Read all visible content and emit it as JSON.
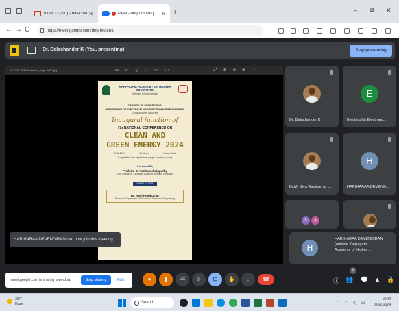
{
  "browser": {
    "tabs": [
      {
        "label": "Inbox (3,090) - balachander.k@k",
        "icon": "gmail-icon",
        "active": false
      },
      {
        "label": "Meet - deq-fxou-ntq",
        "icon": "meet-icon",
        "active": true,
        "recording": true
      }
    ],
    "new_tab": "+",
    "window_controls": {
      "minimize": "–",
      "restore": "⧉",
      "close": "✕"
    },
    "nav": {
      "back": "←",
      "forward": "→",
      "reload": "C"
    },
    "url": "https://meet.google.com/deq-fxou-ntq"
  },
  "meet": {
    "presenting_text": "Dr. Balachander K (You, presenting)",
    "stop_presenting": "Stop presenting",
    "viewer": {
      "filename": "NCCGE 2024 Invitation_page-0001.jpg",
      "tools": "⊕ ↺ ▯ ⊙ ▭ ⋯",
      "tools_right": "⤢ ⊟ ⊖ ⊕ ⋯"
    },
    "poster": {
      "university": "KARPAGAM ACADEMY OF HIGHER EDUCATION",
      "university_sub": "(Deemed to be University)",
      "faculty": "FACULTY OF ENGINEERING",
      "department": "DEPARTMENT OF ELECTRICAL AND ELECTRONICS ENGINEERING",
      "organizes": "Cordially invites you to the",
      "script": "Inaugural function of",
      "conference": "7th NATIONAL CONFERENCE ON",
      "title_line1": "CLEAN AND",
      "title_line2": "GREEN ENERGY 2024",
      "date": "10.02.2024",
      "time": "11.00 am",
      "venue": "Virtual Mode",
      "link": "Google Meet Link: https://meet.google.com/deq-fxou-ntq",
      "presided_by": "Presided By",
      "president": "Prof. Dr. B. Venkatachalapathy",
      "president_role": "Vice Chancellor, Karpagam Academy of Higher Education",
      "chief_guest_label": "CHIEF GUEST",
      "chief_guest": "Dr. Ravi Ramkumar",
      "chief_guest_role": "Professor, Department of Electrical & Electronics Engineering"
    },
    "toast": "HARIHARAA DEVENDIRAN can now join this meeting",
    "participants": [
      {
        "name": "Dr. Balachander K",
        "avatar": "photo"
      },
      {
        "name": "Electrical & Electronc...",
        "avatar": "E",
        "color": "#1e8e3e"
      },
      {
        "name": "Dr.M. Siva Ramkumar ...",
        "avatar": "photo"
      },
      {
        "name": "HARIHARAA DEVEND...",
        "avatar": "H",
        "color": "#6f8fb3"
      }
    ],
    "wide_tile": {
      "name_line1": "HARIHARAA DEVENDIRAN",
      "name_line2": "(outside Karpagam",
      "name_line3": "Academy of Higher ...",
      "avatar": "H",
      "mini_avatars": [
        "S",
        "A"
      ]
    },
    "sharing_notice": "meet.google.com is sharing a window.",
    "stop_sharing": "Stop sharing",
    "hide": "Hide",
    "controls": {
      "mic": "●",
      "camera": "▮",
      "captions": "CC",
      "emoji": "☺",
      "present": "⊡",
      "raise_hand": "✋",
      "more": "⋮",
      "hangup": "☎",
      "info": "ⓘ",
      "people": "👥",
      "chat": "💬",
      "activities": "▲",
      "host": "🔒",
      "people_count": "8"
    }
  },
  "taskbar": {
    "weather_temp": "30°F",
    "weather_desc": "Haze",
    "search": "Search",
    "time": "10:42",
    "date": "10-02-2024"
  }
}
